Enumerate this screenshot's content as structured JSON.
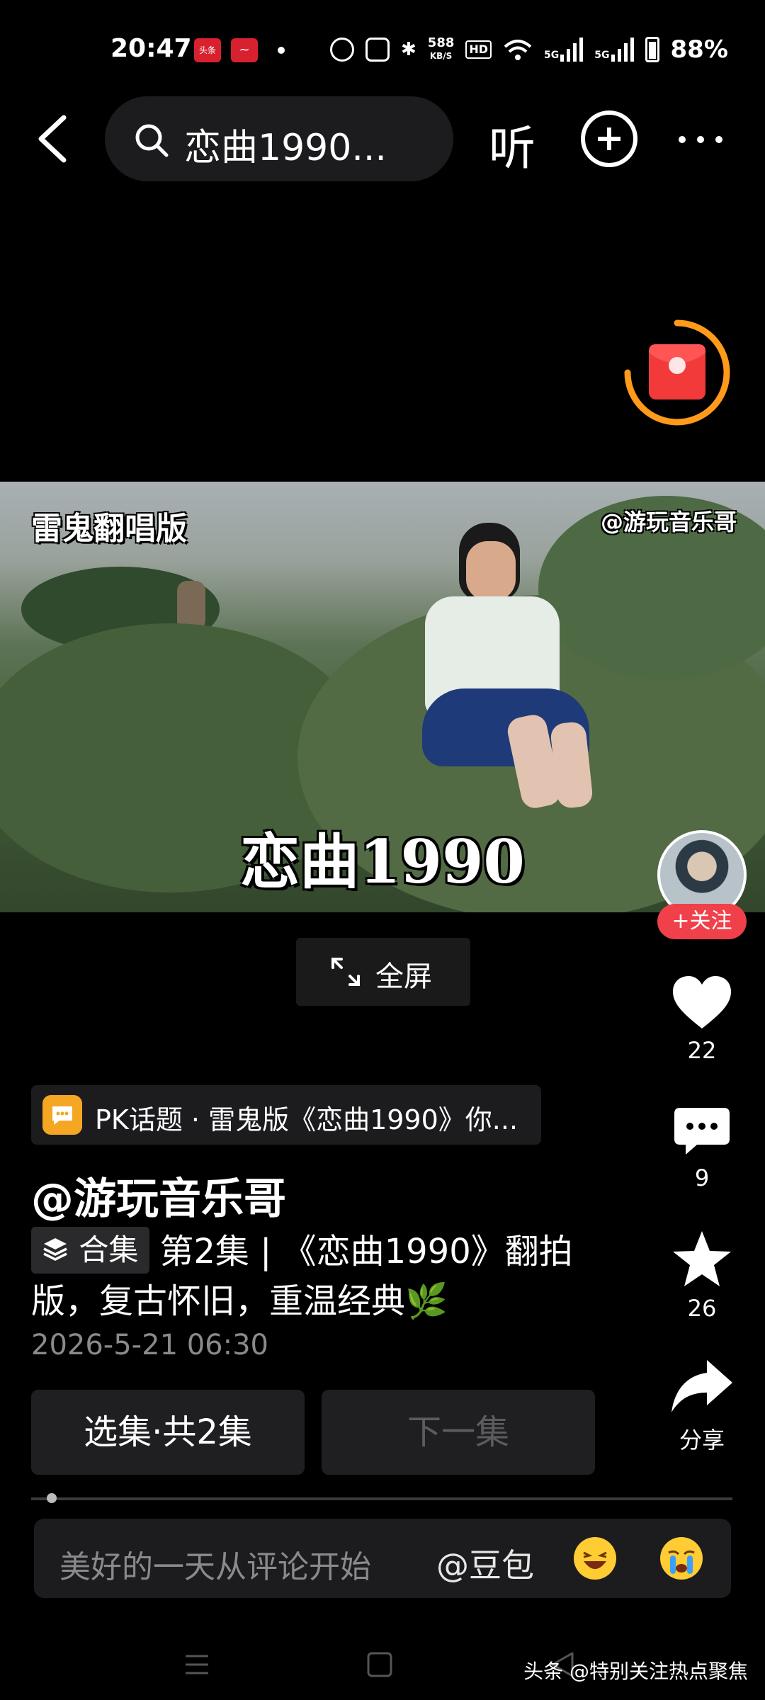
{
  "status_bar": {
    "time": "20:47",
    "app_badge_1": "头条",
    "network_speed": "588",
    "network_unit": "KB/S",
    "hd_label": "HD",
    "signal_1": "5G",
    "signal_2": "5G",
    "battery": "88%"
  },
  "nav": {
    "search_text": "恋曲1990...",
    "listen_label": "听"
  },
  "video": {
    "top_left_caption": "雷鬼翻唱版",
    "top_right_watermark": "@游玩音乐哥",
    "title_overlay": "恋曲1990"
  },
  "rail": {
    "follow_label": "+关注",
    "likes": "22",
    "comments": "9",
    "favorites": "26",
    "share_label": "分享"
  },
  "fullscreen_label": "全屏",
  "pk_topic": "PK话题 · 雷鬼版《恋曲1990》你...",
  "author": "@游玩音乐哥",
  "collection_tag": "合集",
  "description": "第2集 | 《恋曲1990》翻拍版，复古怀旧，重温经典🌿",
  "date": "2026-5-21 06:30",
  "episodes": {
    "select_label": "选集·共2集",
    "next_label": "下一集"
  },
  "comment": {
    "placeholder": "美好的一天从评论开始",
    "mention": "@豆包"
  },
  "watermark": "头条 @特别关注热点聚焦",
  "colors": {
    "accent_red": "#f0404a",
    "packet_orange": "#ff9a1a",
    "pk_orange": "#f5a623"
  }
}
